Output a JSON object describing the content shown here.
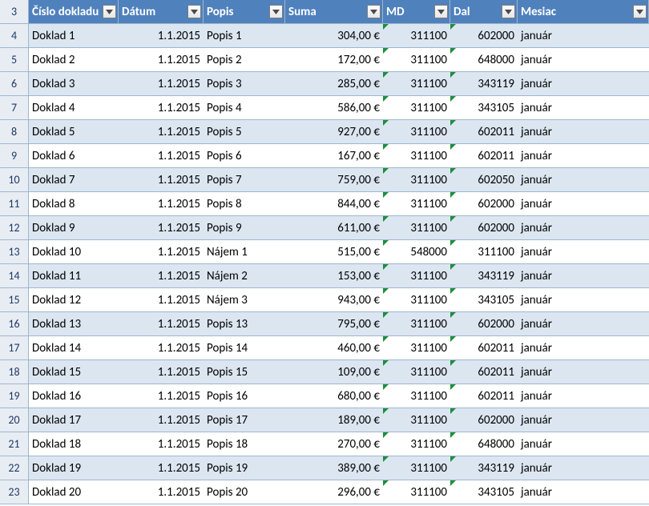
{
  "headers": [
    "Číslo dokladu",
    "Dátum",
    "Popis",
    "Suma",
    "MD",
    "Dal",
    "Mesiac"
  ],
  "startRow": 3,
  "rows": [
    {
      "n": 4,
      "doc": "Doklad 1",
      "date": "1.1.2015",
      "desc": "Popis 1",
      "sum": "304,00 €",
      "md": "311100",
      "dal": "602000",
      "mon": "január"
    },
    {
      "n": 5,
      "doc": "Doklad 2",
      "date": "1.1.2015",
      "desc": "Popis 2",
      "sum": "172,00 €",
      "md": "311100",
      "dal": "648000",
      "mon": "január"
    },
    {
      "n": 6,
      "doc": "Doklad 3",
      "date": "1.1.2015",
      "desc": "Popis 3",
      "sum": "285,00 €",
      "md": "311100",
      "dal": "343119",
      "mon": "január"
    },
    {
      "n": 7,
      "doc": "Doklad 4",
      "date": "1.1.2015",
      "desc": "Popis 4",
      "sum": "586,00 €",
      "md": "311100",
      "dal": "343105",
      "mon": "január"
    },
    {
      "n": 8,
      "doc": "Doklad 5",
      "date": "1.1.2015",
      "desc": "Popis 5",
      "sum": "927,00 €",
      "md": "311100",
      "dal": "602011",
      "mon": "január"
    },
    {
      "n": 9,
      "doc": "Doklad 6",
      "date": "1.1.2015",
      "desc": "Popis 6",
      "sum": "167,00 €",
      "md": "311100",
      "dal": "602011",
      "mon": "január"
    },
    {
      "n": 10,
      "doc": "Doklad 7",
      "date": "1.1.2015",
      "desc": "Popis 7",
      "sum": "759,00 €",
      "md": "311100",
      "dal": "602050",
      "mon": "január"
    },
    {
      "n": 11,
      "doc": "Doklad 8",
      "date": "1.1.2015",
      "desc": "Popis 8",
      "sum": "844,00 €",
      "md": "311100",
      "dal": "602000",
      "mon": "január"
    },
    {
      "n": 12,
      "doc": "Doklad 9",
      "date": "1.1.2015",
      "desc": "Popis 9",
      "sum": "611,00 €",
      "md": "311100",
      "dal": "602000",
      "mon": "január"
    },
    {
      "n": 13,
      "doc": "Doklad 10",
      "date": "1.1.2015",
      "desc": "Nájem 1",
      "sum": "515,00 €",
      "md": "548000",
      "dal": "311100",
      "mon": "január"
    },
    {
      "n": 14,
      "doc": "Doklad 11",
      "date": "1.1.2015",
      "desc": "Nájem 2",
      "sum": "153,00 €",
      "md": "311100",
      "dal": "343119",
      "mon": "január"
    },
    {
      "n": 15,
      "doc": "Doklad 12",
      "date": "1.1.2015",
      "desc": "Nájem 3",
      "sum": "943,00 €",
      "md": "311100",
      "dal": "343105",
      "mon": "január"
    },
    {
      "n": 16,
      "doc": "Doklad 13",
      "date": "1.1.2015",
      "desc": "Popis 13",
      "sum": "795,00 €",
      "md": "311100",
      "dal": "602000",
      "mon": "január"
    },
    {
      "n": 17,
      "doc": "Doklad 14",
      "date": "1.1.2015",
      "desc": "Popis 14",
      "sum": "460,00 €",
      "md": "311100",
      "dal": "602011",
      "mon": "január"
    },
    {
      "n": 18,
      "doc": "Doklad 15",
      "date": "1.1.2015",
      "desc": "Popis 15",
      "sum": "109,00 €",
      "md": "311100",
      "dal": "602011",
      "mon": "január"
    },
    {
      "n": 19,
      "doc": "Doklad 16",
      "date": "1.1.2015",
      "desc": "Popis 16",
      "sum": "680,00 €",
      "md": "311100",
      "dal": "602011",
      "mon": "január"
    },
    {
      "n": 20,
      "doc": "Doklad 17",
      "date": "1.1.2015",
      "desc": "Popis 17",
      "sum": "189,00 €",
      "md": "311100",
      "dal": "602000",
      "mon": "január"
    },
    {
      "n": 21,
      "doc": "Doklad 18",
      "date": "1.1.2015",
      "desc": "Popis 18",
      "sum": "270,00 €",
      "md": "311100",
      "dal": "648000",
      "mon": "január"
    },
    {
      "n": 22,
      "doc": "Doklad 19",
      "date": "1.1.2015",
      "desc": "Popis 19",
      "sum": "389,00 €",
      "md": "311100",
      "dal": "343119",
      "mon": "január"
    },
    {
      "n": 23,
      "doc": "Doklad 20",
      "date": "1.1.2015",
      "desc": "Popis 20",
      "sum": "296,00 €",
      "md": "311100",
      "dal": "343105",
      "mon": "január"
    }
  ]
}
